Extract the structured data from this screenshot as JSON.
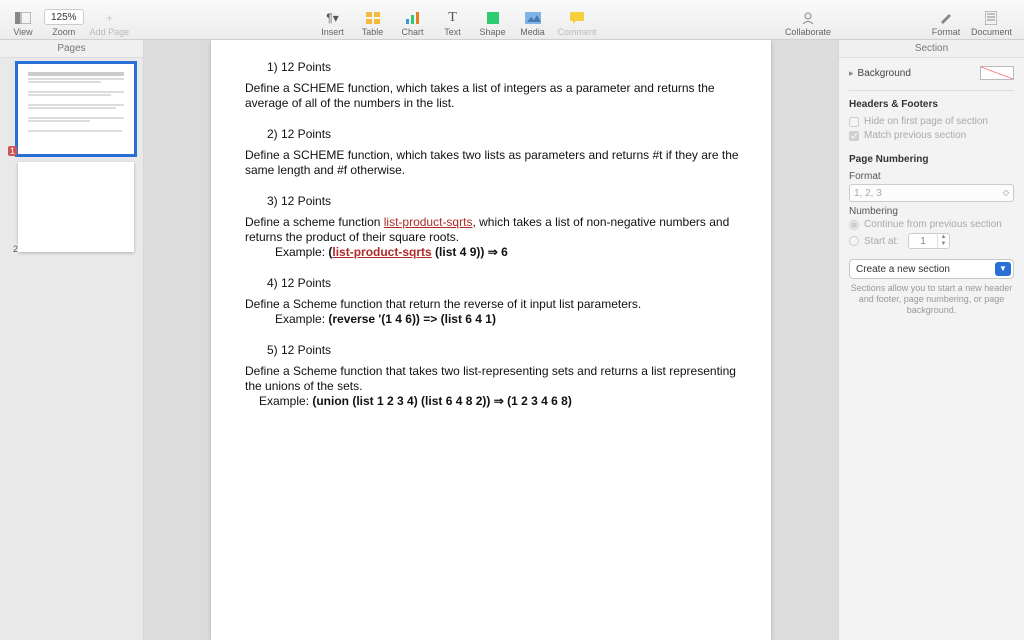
{
  "toolbar": {
    "view": "View",
    "zoom_value": "125%",
    "zoom": "Zoom",
    "add_page": "Add Page",
    "insert": "Insert",
    "table": "Table",
    "chart": "Chart",
    "text": "Text",
    "shape": "Shape",
    "media": "Media",
    "comment": "Comment",
    "collaborate": "Collaborate",
    "format": "Format",
    "document": "Document"
  },
  "thumbs": {
    "header": "Pages",
    "pages": [
      "1",
      "2"
    ]
  },
  "doc": {
    "q1": {
      "head": "1)  12 Points",
      "body": "Define a SCHEME function, which takes a list of integers as a parameter and returns the average of all of the numbers in the list."
    },
    "q2": {
      "head": "2)  12 Points",
      "body": "Define a SCHEME function, which takes two lists as parameters and returns #t if they are the same length and #f otherwise."
    },
    "q3": {
      "head": "3)  12 Points",
      "body_a": "Define a scheme function ",
      "body_b": "list-product-sqrts",
      "body_c": ", which takes a list of non-negative numbers and returns the product of their square roots.",
      "ex_label": "Example: ",
      "ex_a": "(",
      "ex_b": "list-product-sqrts",
      "ex_c": " (list 4 9)) ⇒ 6"
    },
    "q4": {
      "head": "4)  12 Points",
      "body": "Define a Scheme function that return the reverse of it input list parameters.",
      "ex_label": "Example: ",
      "ex": "(reverse '(1 4 6)) => (list 6 4 1)"
    },
    "q5": {
      "head": "5)  12 Points",
      "body": "Define a Scheme function that takes two list-representing sets and returns a list representing the unions of the sets.",
      "ex_label": "Example: ",
      "ex": "(union (list 1 2 3 4) (list 6 4 8 2)) ⇒ (1 2 3 4 6 8)"
    }
  },
  "inspector": {
    "header": "Section",
    "background": "Background",
    "hf_title": "Headers & Footers",
    "hide_first": "Hide on first page of section",
    "match_prev": "Match previous section",
    "pn_title": "Page Numbering",
    "format_label": "Format",
    "format_value": "1, 2, 3",
    "numbering_label": "Numbering",
    "continue": "Continue from previous section",
    "start_at": "Start at:",
    "start_val": "1",
    "create": "Create a new section",
    "hint": "Sections allow you to start a new header and footer, page numbering, or page background."
  }
}
